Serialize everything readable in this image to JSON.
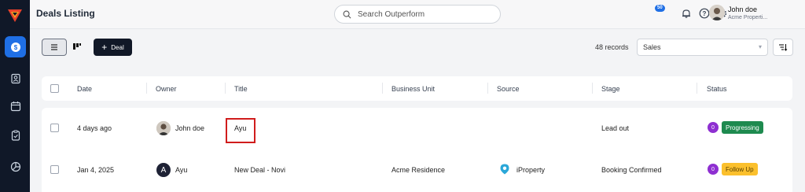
{
  "header": {
    "title": "Deals Listing",
    "search_placeholder": "Search Outperform",
    "notification_count": "50",
    "user_name": "John doe",
    "user_company": "Acme Properti..."
  },
  "sidebar": {
    "items": [
      {
        "icon": "dollar-icon",
        "active": true
      },
      {
        "icon": "contacts-icon",
        "active": false
      },
      {
        "icon": "calendar-icon",
        "active": false
      },
      {
        "icon": "clipboard-icon",
        "active": false
      },
      {
        "icon": "pie-chart-icon",
        "active": false
      }
    ]
  },
  "toolbar": {
    "add_deal_label": "Deal",
    "records_label": "48 records",
    "pipeline_value": "Sales"
  },
  "table": {
    "columns": [
      "Date",
      "Owner",
      "Title",
      "Business Unit",
      "Source",
      "Stage",
      "Status"
    ],
    "rows": [
      {
        "date": "4 days ago",
        "owner": "John doe",
        "owner_avatar": "photo",
        "title": "Ayu",
        "business_unit": "",
        "source": "",
        "stage": "Lead out",
        "count": "0",
        "status": "Progressing",
        "status_color": "#1e8a4f"
      },
      {
        "date": "Jan 4, 2025",
        "owner": "Ayu",
        "owner_avatar": "A",
        "title": "New Deal - Novi",
        "business_unit": "Acme Residence",
        "source": "iProperty",
        "stage": "Booking Confirmed",
        "count": "0",
        "status": "Follow Up",
        "status_color": "#fbc02d"
      }
    ]
  },
  "colors": {
    "accent": "#1f6fe5",
    "sidebar": "#101828",
    "highlight": "#d01c1c"
  }
}
